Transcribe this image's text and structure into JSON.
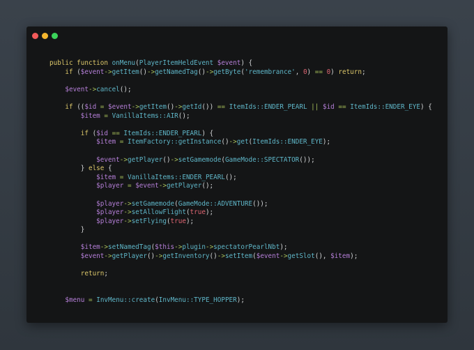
{
  "window": {
    "controls": [
      {
        "name": "close",
        "color": "#f25a5a"
      },
      {
        "name": "minimize",
        "color": "#f5b62e"
      },
      {
        "name": "maximize",
        "color": "#3bd35a"
      }
    ]
  },
  "code": {
    "lines": [
      [
        [
          "p",
          ""
        ],
        [
          "k",
          "public function "
        ],
        [
          "f",
          "onMenu"
        ],
        [
          "p",
          "("
        ],
        [
          "c",
          "PlayerItemHeldEvent "
        ],
        [
          "v",
          "$event"
        ],
        [
          "p",
          ") {"
        ]
      ],
      [
        [
          "p",
          "    "
        ],
        [
          "k",
          "if "
        ],
        [
          "p",
          "("
        ],
        [
          "v",
          "$event"
        ],
        [
          "o",
          "->"
        ],
        [
          "f",
          "getItem"
        ],
        [
          "p",
          "()"
        ],
        [
          "o",
          "->"
        ],
        [
          "f",
          "getNamedTag"
        ],
        [
          "p",
          "()"
        ],
        [
          "o",
          "->"
        ],
        [
          "f",
          "getByte"
        ],
        [
          "p",
          "("
        ],
        [
          "s",
          "'remembrance'"
        ],
        [
          "p",
          ", "
        ],
        [
          "n",
          "0"
        ],
        [
          "p",
          ") "
        ],
        [
          "o",
          "=="
        ],
        [
          "p",
          " "
        ],
        [
          "n",
          "0"
        ],
        [
          "p",
          ") "
        ],
        [
          "k",
          "return"
        ],
        [
          "p",
          ";"
        ]
      ],
      [],
      [
        [
          "p",
          "    "
        ],
        [
          "v",
          "$event"
        ],
        [
          "o",
          "->"
        ],
        [
          "f",
          "cancel"
        ],
        [
          "p",
          "();"
        ]
      ],
      [],
      [
        [
          "p",
          "    "
        ],
        [
          "k",
          "if "
        ],
        [
          "p",
          "(("
        ],
        [
          "v",
          "$id"
        ],
        [
          "p",
          " "
        ],
        [
          "o",
          "="
        ],
        [
          "p",
          " "
        ],
        [
          "v",
          "$event"
        ],
        [
          "o",
          "->"
        ],
        [
          "f",
          "getItem"
        ],
        [
          "p",
          "()"
        ],
        [
          "o",
          "->"
        ],
        [
          "f",
          "getId"
        ],
        [
          "p",
          "()) "
        ],
        [
          "o",
          "=="
        ],
        [
          "p",
          " "
        ],
        [
          "c",
          "ItemIds::ENDER_PEARL"
        ],
        [
          "p",
          " "
        ],
        [
          "o",
          "||"
        ],
        [
          "p",
          " "
        ],
        [
          "v",
          "$id"
        ],
        [
          "p",
          " "
        ],
        [
          "o",
          "=="
        ],
        [
          "p",
          " "
        ],
        [
          "c",
          "ItemIds::ENDER_EYE"
        ],
        [
          "p",
          ") {"
        ]
      ],
      [
        [
          "p",
          "        "
        ],
        [
          "v",
          "$item"
        ],
        [
          "p",
          " "
        ],
        [
          "o",
          "="
        ],
        [
          "p",
          " "
        ],
        [
          "c",
          "VanillaItems::AIR"
        ],
        [
          "p",
          "();"
        ]
      ],
      [],
      [
        [
          "p",
          "        "
        ],
        [
          "k",
          "if "
        ],
        [
          "p",
          "("
        ],
        [
          "v",
          "$id"
        ],
        [
          "p",
          " "
        ],
        [
          "o",
          "=="
        ],
        [
          "p",
          " "
        ],
        [
          "c",
          "ItemIds::ENDER_PEARL"
        ],
        [
          "p",
          ") {"
        ]
      ],
      [
        [
          "p",
          "            "
        ],
        [
          "v",
          "$item"
        ],
        [
          "p",
          " "
        ],
        [
          "o",
          "="
        ],
        [
          "p",
          " "
        ],
        [
          "c",
          "ItemFactory::getInstance"
        ],
        [
          "p",
          "()"
        ],
        [
          "o",
          "->"
        ],
        [
          "f",
          "get"
        ],
        [
          "p",
          "("
        ],
        [
          "c",
          "ItemIds::ENDER_EYE"
        ],
        [
          "p",
          ");"
        ]
      ],
      [],
      [
        [
          "p",
          "            "
        ],
        [
          "v",
          "$event"
        ],
        [
          "o",
          "->"
        ],
        [
          "f",
          "getPlayer"
        ],
        [
          "p",
          "()"
        ],
        [
          "o",
          "->"
        ],
        [
          "f",
          "setGamemode"
        ],
        [
          "p",
          "("
        ],
        [
          "c",
          "GameMode::SPECTATOR"
        ],
        [
          "p",
          "());"
        ]
      ],
      [
        [
          "p",
          "        } "
        ],
        [
          "k",
          "else"
        ],
        [
          "p",
          " {"
        ]
      ],
      [
        [
          "p",
          "            "
        ],
        [
          "v",
          "$item"
        ],
        [
          "p",
          " "
        ],
        [
          "o",
          "="
        ],
        [
          "p",
          " "
        ],
        [
          "c",
          "VanillaItems::ENDER_PEARL"
        ],
        [
          "p",
          "();"
        ]
      ],
      [
        [
          "p",
          "            "
        ],
        [
          "v",
          "$player"
        ],
        [
          "p",
          " "
        ],
        [
          "o",
          "="
        ],
        [
          "p",
          " "
        ],
        [
          "v",
          "$event"
        ],
        [
          "o",
          "->"
        ],
        [
          "f",
          "getPlayer"
        ],
        [
          "p",
          "();"
        ]
      ],
      [],
      [
        [
          "p",
          "            "
        ],
        [
          "v",
          "$player"
        ],
        [
          "o",
          "->"
        ],
        [
          "f",
          "setGamemode"
        ],
        [
          "p",
          "("
        ],
        [
          "c",
          "GameMode::ADVENTURE"
        ],
        [
          "p",
          "());"
        ]
      ],
      [
        [
          "p",
          "            "
        ],
        [
          "v",
          "$player"
        ],
        [
          "o",
          "->"
        ],
        [
          "f",
          "setAllowFlight"
        ],
        [
          "p",
          "("
        ],
        [
          "n",
          "true"
        ],
        [
          "p",
          ");"
        ]
      ],
      [
        [
          "p",
          "            "
        ],
        [
          "v",
          "$player"
        ],
        [
          "o",
          "->"
        ],
        [
          "f",
          "setFlying"
        ],
        [
          "p",
          "("
        ],
        [
          "n",
          "true"
        ],
        [
          "p",
          ");"
        ]
      ],
      [
        [
          "p",
          "        }"
        ]
      ],
      [],
      [
        [
          "p",
          "        "
        ],
        [
          "v",
          "$item"
        ],
        [
          "o",
          "->"
        ],
        [
          "f",
          "setNamedTag"
        ],
        [
          "p",
          "("
        ],
        [
          "v",
          "$this"
        ],
        [
          "o",
          "->"
        ],
        [
          "f",
          "plugin"
        ],
        [
          "o",
          "->"
        ],
        [
          "f",
          "spectatorPearlNbt"
        ],
        [
          "p",
          ");"
        ]
      ],
      [
        [
          "p",
          "        "
        ],
        [
          "v",
          "$event"
        ],
        [
          "o",
          "->"
        ],
        [
          "f",
          "getPlayer"
        ],
        [
          "p",
          "()"
        ],
        [
          "o",
          "->"
        ],
        [
          "f",
          "getInventory"
        ],
        [
          "p",
          "()"
        ],
        [
          "o",
          "->"
        ],
        [
          "f",
          "setItem"
        ],
        [
          "p",
          "("
        ],
        [
          "v",
          "$event"
        ],
        [
          "o",
          "->"
        ],
        [
          "f",
          "getSlot"
        ],
        [
          "p",
          "(), "
        ],
        [
          "v",
          "$item"
        ],
        [
          "p",
          ");"
        ]
      ],
      [],
      [
        [
          "p",
          "        "
        ],
        [
          "k",
          "return"
        ],
        [
          "p",
          ";"
        ]
      ],
      [],
      [],
      [
        [
          "p",
          "    "
        ],
        [
          "v",
          "$menu"
        ],
        [
          "p",
          " "
        ],
        [
          "o",
          "="
        ],
        [
          "p",
          " "
        ],
        [
          "c",
          "InvMenu::create"
        ],
        [
          "p",
          "("
        ],
        [
          "c",
          "InvMenu::TYPE_HOPPER"
        ],
        [
          "p",
          ");"
        ]
      ]
    ]
  }
}
